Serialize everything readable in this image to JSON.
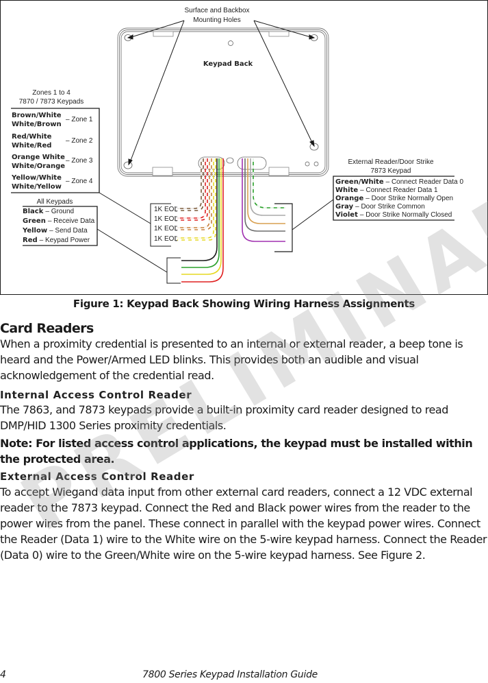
{
  "figure": {
    "mounting_label_line1": "Surface and Backbox",
    "mounting_label_line2": "Mounting Holes",
    "keypad_back_label": "Keypad Back",
    "zones_heading_line1": "Zones 1 to 4",
    "zones_heading_line2": "7870 / 7873 Keypads",
    "zones": [
      {
        "wire1": "Brown/White",
        "wire2": "White/Brown",
        "zone": "– Zone 1"
      },
      {
        "wire1": "Red/White",
        "wire2": "White/Red",
        "zone": "– Zone 2"
      },
      {
        "wire1": "Orange White",
        "wire2": "White/Orange",
        "zone": "– Zone 3"
      },
      {
        "wire1": "Yellow/White",
        "wire2": "White/Yellow",
        "zone": "– Zone 4"
      }
    ],
    "all_keypads_heading": "All Keypads",
    "all_keypads": [
      {
        "color": "Black",
        "function": "–  Ground"
      },
      {
        "color": "Green",
        "function": "– Receive Data"
      },
      {
        "color": "Yellow",
        "function": "– Send Data"
      },
      {
        "color": "Red",
        "function": "– Keypad Power"
      }
    ],
    "eol_labels": [
      "1K EOL",
      "1K EOL",
      "1K EOL",
      "1K EOL"
    ],
    "external_heading_line1": "External Reader/Door Strike",
    "external_heading_line2": "7873 Keypad",
    "external": [
      {
        "color": "Green/White",
        "function": "– Connect Reader Data 0"
      },
      {
        "color": "White",
        "function": "– Connect Reader Data 1"
      },
      {
        "color": "Orange",
        "function": "– Door Strike Normally Open"
      },
      {
        "color": "Gray",
        "function": "– Door Strike Common"
      },
      {
        "color": "Violet",
        "function": "– Door Strike Normally Closed"
      }
    ],
    "wire_colors": {
      "brown": "#7a5a3a",
      "red": "#e02020",
      "orange": "#c8803c",
      "yellow": "#e6d820",
      "black": "#1a1a1a",
      "green": "#2aa02a",
      "gray": "#6e6e6e",
      "violet": "#a030b0",
      "light_orange": "#d8a050",
      "white": "#ffffff"
    }
  },
  "caption": "Figure 1: Keypad Back Showing Wiring Harness Assignments",
  "section_title": "Card Readers",
  "section_intro": "When a proximity credential is presented to an internal or external reader, a beep tone is heard and the Power/Armed LED blinks.  This provides both an audible and visual acknowledgement of the credential read.",
  "internal": {
    "title": "Internal Access Control Reader",
    "body": "The 7863, and 7873 keypads provide a built-in proximity card reader designed to read DMP/HID 1300 Series proximity credentials.",
    "note": "Note: For listed access control applications, the keypad must be installed within the protected area."
  },
  "external_section": {
    "title": "External Access Control Reader",
    "body": "To accept Wiegand data input from other external card readers, connect a 12 VDC external reader to the 7873 keypad.  Connect the Red and Black power wires from the reader to the power wires from the panel.  These connect in parallel with the keypad power wires.  Connect the Reader (Data 1) wire to the White wire on the 5-wire keypad harness.  Connect the Reader (Data 0) wire to the Green/White wire on the 5-wire keypad harness.  See Figure 2."
  },
  "watermark": "PRELIMINARY",
  "footer": {
    "page_number": "4",
    "guide_title": "7800 Series Keypad Installation Guide"
  }
}
